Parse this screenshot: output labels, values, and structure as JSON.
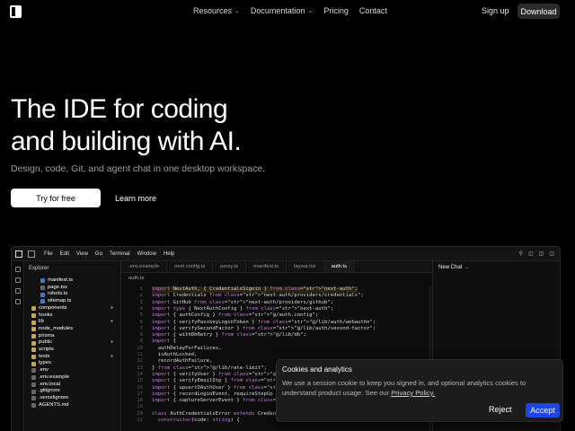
{
  "nav": {
    "links": [
      {
        "label": "Resources",
        "has_dropdown": true
      },
      {
        "label": "Documentation",
        "has_dropdown": true
      },
      {
        "label": "Pricing",
        "has_dropdown": false
      },
      {
        "label": "Contact",
        "has_dropdown": false
      }
    ],
    "signup": "Sign up",
    "download": "Download"
  },
  "hero": {
    "title_line1": "The IDE for coding",
    "title_line2": "and building with AI.",
    "subtitle": "Design, code, Git, and agent chat in one desktop workspace.",
    "primary_cta": "Try for free",
    "secondary_cta": "Learn more"
  },
  "ide": {
    "menus": [
      "File",
      "Edit",
      "View",
      "Go",
      "Terminal",
      "Window",
      "Help"
    ],
    "explorer_title": "Explorer",
    "tree": [
      {
        "type": "ts",
        "label": "manifest.ts",
        "depth": 1
      },
      {
        "type": "file",
        "label": "page.tsx",
        "depth": 1
      },
      {
        "type": "ts",
        "label": "robots.ts",
        "depth": 1
      },
      {
        "type": "ts",
        "label": "sitemap.ts",
        "depth": 1
      },
      {
        "type": "folder",
        "label": "components",
        "depth": 0,
        "modified": true
      },
      {
        "type": "folder",
        "label": "hooks",
        "depth": 0
      },
      {
        "type": "folder",
        "label": "lib",
        "depth": 0,
        "modified": true
      },
      {
        "type": "folder",
        "label": "node_modules",
        "depth": 0
      },
      {
        "type": "folder",
        "label": "prisma",
        "depth": 0
      },
      {
        "type": "folder",
        "label": "public",
        "depth": 0,
        "modified": true
      },
      {
        "type": "folder",
        "label": "scripts",
        "depth": 0
      },
      {
        "type": "folder",
        "label": "tests",
        "depth": 0,
        "modified": true
      },
      {
        "type": "folder",
        "label": "types",
        "depth": 0
      },
      {
        "type": "file",
        "label": ".env",
        "depth": 0
      },
      {
        "type": "file",
        "label": ".env.example",
        "depth": 0
      },
      {
        "type": "file",
        "label": ".env.local",
        "depth": 0
      },
      {
        "type": "file",
        "label": ".gitignore",
        "depth": 0
      },
      {
        "type": "file",
        "label": ".vercelignore",
        "depth": 0
      },
      {
        "type": "file",
        "label": "AGENTS.md",
        "depth": 0
      }
    ],
    "tabs": [
      {
        "label": ".env.example",
        "active": false
      },
      {
        "label": "next.config.ts",
        "active": false
      },
      {
        "label": "proxy.ts",
        "active": false
      },
      {
        "label": "manifest.ts",
        "active": false
      },
      {
        "label": "layout.tsx",
        "active": false
      },
      {
        "label": "auth.ts",
        "active": true
      }
    ],
    "breadcrumb": "auth.ts",
    "chat_title": "New Chat",
    "code_lines": [
      {
        "n": "1",
        "text": "import NextAuth, { CredentialsSignin } from \"next-auth\";",
        "highlight": true
      },
      {
        "n": "2",
        "text": "import Credentials from \"next-auth/providers/credentials\";",
        "highlight": false
      },
      {
        "n": "3",
        "text": "import GitHub from \"next-auth/providers/github\";",
        "highlight": false
      },
      {
        "n": "4",
        "text": "import type { NextAuthConfig } from \"next-auth\";",
        "highlight": false
      },
      {
        "n": "5",
        "text": "import { authConfig } from \"@/auth.config\";",
        "highlight": false
      },
      {
        "n": "6",
        "text": "import { verifyPasskeyLoginToken } from \"@/lib/auth/webauthn\";",
        "highlight": false
      },
      {
        "n": "7",
        "text": "import { verifySecondFactor } from \"@/lib/auth/second-factor\";",
        "highlight": false
      },
      {
        "n": "8",
        "text": "import { withDbRetry } from \"@/lib/db\";",
        "highlight": false
      },
      {
        "n": "9",
        "text": "import {",
        "highlight": false
      },
      {
        "n": "10",
        "text": "  authDelayForFailures,",
        "highlight": false
      },
      {
        "n": "11",
        "text": "  isAuthLocked,",
        "highlight": false
      },
      {
        "n": "12",
        "text": "  recordAuthFailure,",
        "highlight": false
      },
      {
        "n": "13",
        "text": "} from \"@/lib/rate-limit\";",
        "highlight": false
      },
      {
        "n": "14",
        "text": "import { verifyUser } from \"@/lib/servic",
        "highlight": false
      },
      {
        "n": "15",
        "text": "import { verifyEmailOtp } from \"@/lib/se",
        "highlight": false
      },
      {
        "n": "16",
        "text": "import { upsertOAuthUser } from \"@/lib/se",
        "highlight": false
      },
      {
        "n": "17",
        "text": "import { recordLoginEvent, requireStepUp",
        "highlight": false
      },
      {
        "n": "18",
        "text": "import { captureServerEvent } from \"@/lib",
        "highlight": false
      },
      {
        "n": "19",
        "text": "",
        "highlight": false
      },
      {
        "n": "20",
        "text": "class AuthCredentialsError extends CredentialsSignin {",
        "highlight": false
      },
      {
        "n": "21",
        "text": "  constructor(code: string) {",
        "highlight": false
      }
    ]
  },
  "cookie": {
    "title": "Cookies and analytics",
    "text": "We use a session cookie to keep you signed in, and optional analytics cookies to understand product usage. See our",
    "link": "Privacy Policy.",
    "reject": "Reject",
    "accept": "Accept"
  },
  "colors": {
    "accent": "#1c47e0",
    "background": "#000000",
    "modified_dot": "#d6a443"
  }
}
